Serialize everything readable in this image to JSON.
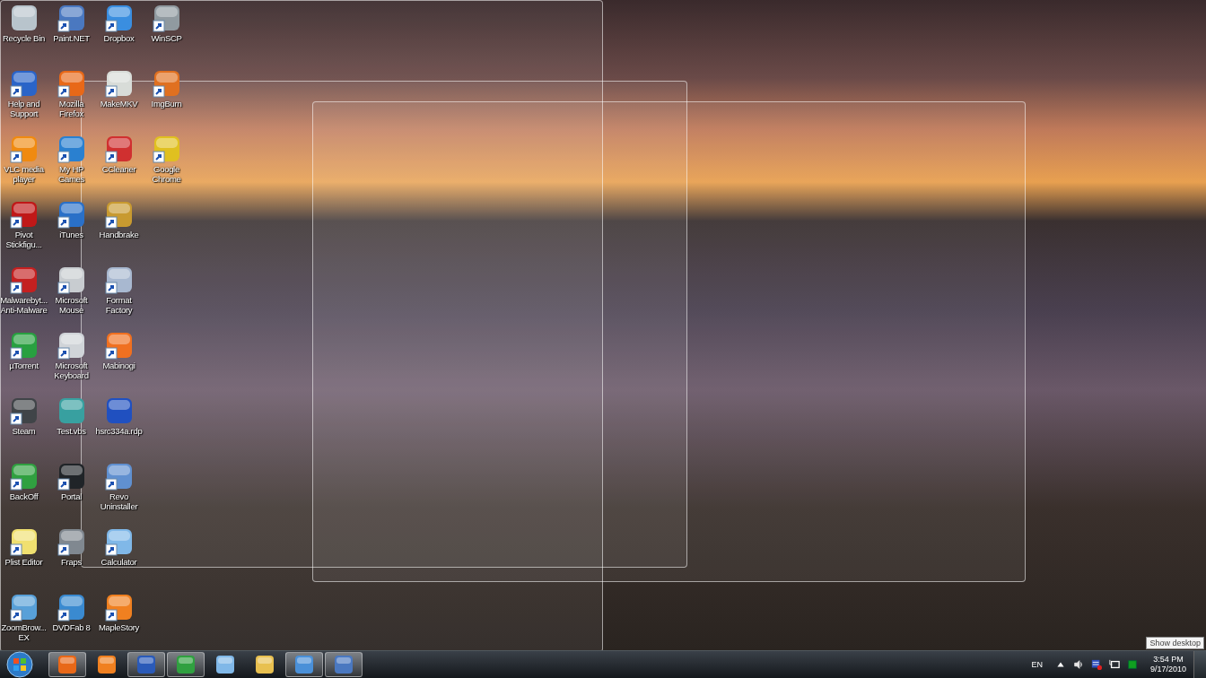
{
  "desktop": {
    "icon_columns": [
      [
        {
          "label": "Recycle Bin",
          "shortcut": false,
          "color": "#b8c4cc"
        },
        {
          "label": "Help and Support",
          "shortcut": true,
          "color": "#2a64c8"
        },
        {
          "label": "VLC media player",
          "shortcut": true,
          "color": "#f08a10"
        },
        {
          "label": "Pivot Stickfigu...",
          "shortcut": true,
          "color": "#c01818"
        },
        {
          "label": "Malwarebyt... Anti-Malware",
          "shortcut": true,
          "color": "#c42020"
        },
        {
          "label": "µTorrent",
          "shortcut": true,
          "color": "#28a040"
        },
        {
          "label": "Steam",
          "shortcut": true,
          "color": "#404448"
        },
        {
          "label": "BackOff",
          "shortcut": true,
          "color": "#30a040"
        },
        {
          "label": "Plist Editor",
          "shortcut": true,
          "color": "#f0e070"
        },
        {
          "label": "ZoomBrow... EX",
          "shortcut": true,
          "color": "#58a0d8"
        }
      ],
      [
        {
          "label": "Paint.NET",
          "shortcut": true,
          "color": "#4a78c0"
        },
        {
          "label": "Mozilla Firefox",
          "shortcut": true,
          "color": "#e86818"
        },
        {
          "label": "My HP Games",
          "shortcut": true,
          "color": "#2a80d0"
        },
        {
          "label": "iTunes",
          "shortcut": true,
          "color": "#2a70c8"
        },
        {
          "label": "Microsoft Mouse",
          "shortcut": true,
          "color": "#c8ccd0"
        },
        {
          "label": "Microsoft Keyboard",
          "shortcut": true,
          "color": "#d0d4d8"
        },
        {
          "label": "Test.vbs",
          "shortcut": false,
          "color": "#38a0a0"
        },
        {
          "label": "Portal",
          "shortcut": true,
          "color": "#202428"
        },
        {
          "label": "Fraps",
          "shortcut": true,
          "color": "#808890"
        },
        {
          "label": "DVDFab 8",
          "shortcut": true,
          "color": "#3a8ad0"
        }
      ],
      [
        {
          "label": "Dropbox",
          "shortcut": true,
          "color": "#3a8ee0"
        },
        {
          "label": "MakeMKV",
          "shortcut": true,
          "color": "#d8dcd8"
        },
        {
          "label": "CCleaner",
          "shortcut": true,
          "color": "#d03030"
        },
        {
          "label": "Handbrake",
          "shortcut": true,
          "color": "#c89a30"
        },
        {
          "label": "Format Factory",
          "shortcut": true,
          "color": "#a8b8d0"
        },
        {
          "label": "Mabinogi",
          "shortcut": true,
          "color": "#f07020"
        },
        {
          "label": "hsrc334a.rdp",
          "shortcut": false,
          "color": "#2050c0"
        },
        {
          "label": "Revo Uninstaller",
          "shortcut": true,
          "color": "#6090d0"
        },
        {
          "label": "Calculator",
          "shortcut": true,
          "color": "#80b8e8"
        },
        {
          "label": "MapleStory",
          "shortcut": true,
          "color": "#f08020"
        }
      ],
      [
        {
          "label": "WinSCP",
          "shortcut": true,
          "color": "#909aa0"
        },
        {
          "label": "ImgBurn",
          "shortcut": true,
          "color": "#e07020"
        },
        {
          "label": "Google Chrome",
          "shortcut": true,
          "color": "#e0c020"
        }
      ]
    ]
  },
  "taskbar": {
    "pinned": [
      {
        "running": true,
        "color": "#e86818"
      },
      {
        "running": false,
        "color": "#f08020"
      },
      {
        "running": true,
        "color": "#2a5ab8"
      },
      {
        "running": true,
        "color": "#30a040"
      },
      {
        "running": false,
        "color": "#80b8e8"
      },
      {
        "running": false,
        "color": "#e8c050"
      },
      {
        "running": true,
        "color": "#4a90d8"
      },
      {
        "running": true,
        "color": "#4a78c0"
      }
    ],
    "tray": {
      "language": "EN",
      "time": "3:54 PM",
      "date": "9/17/2010"
    },
    "tooltip": "Show desktop"
  }
}
